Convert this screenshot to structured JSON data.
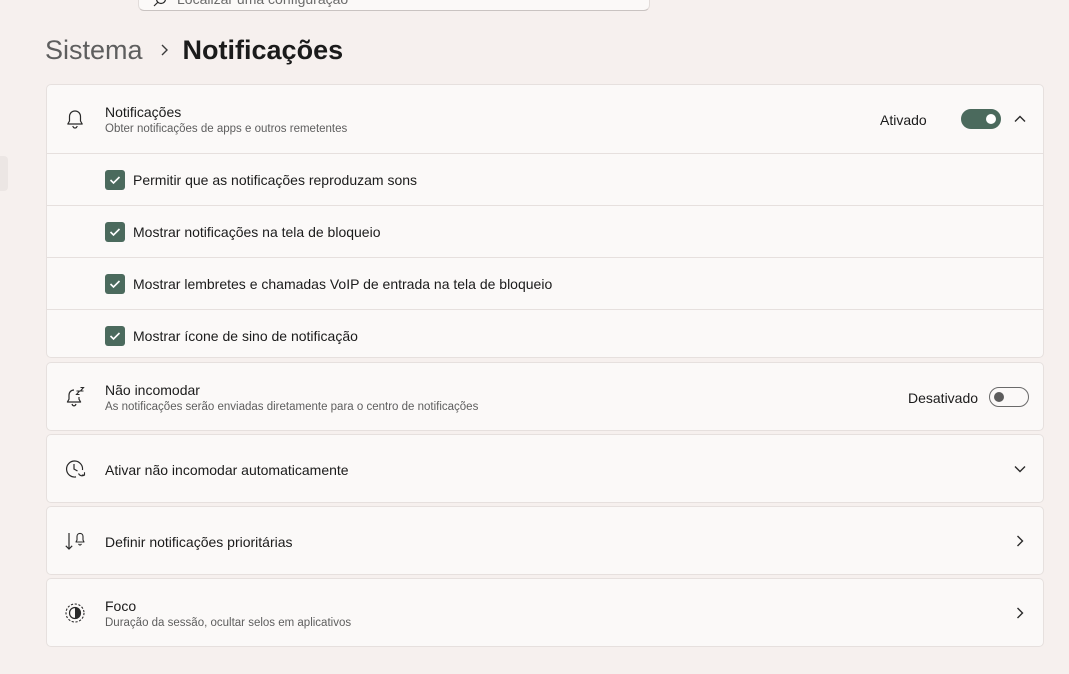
{
  "search": {
    "placeholder": "Localizar uma configuração"
  },
  "breadcrumb": {
    "parent": "Sistema",
    "current": "Notificações"
  },
  "notifications": {
    "title": "Notificações",
    "subtitle": "Obter notificações de apps e outros remetentes",
    "state_label": "Ativado",
    "enabled": true,
    "expanded": true,
    "options": [
      {
        "label": "Permitir que as notificações reproduzam sons",
        "checked": true
      },
      {
        "label": "Mostrar notificações na tela de bloqueio",
        "checked": true
      },
      {
        "label": "Mostrar lembretes e chamadas VoIP de entrada na tela de bloqueio",
        "checked": true
      },
      {
        "label": "Mostrar ícone de sino de notificação",
        "checked": true
      }
    ]
  },
  "do_not_disturb": {
    "title": "Não incomodar",
    "subtitle": "As notificações serão enviadas diretamente para o centro de notificações",
    "state_label": "Desativado",
    "enabled": false
  },
  "auto_dnd": {
    "title": "Ativar não incomodar automaticamente"
  },
  "priority": {
    "title": "Definir notificações prioritárias"
  },
  "focus": {
    "title": "Foco",
    "subtitle": "Duração da sessão, ocultar selos em aplicativos"
  },
  "colors": {
    "accent": "#4b6a5d",
    "background": "#f6f0ee",
    "card": "#fbf9f8"
  },
  "icons": {
    "search": "search-icon",
    "breadcrumb_separator": "chevron-right-icon",
    "notifications": "bell-icon",
    "do_not_disturb": "bell-snooze-icon",
    "auto_dnd": "clock-refresh-icon",
    "priority": "priority-sort-icon",
    "focus": "focus-icon",
    "check": "checkmark-icon"
  }
}
